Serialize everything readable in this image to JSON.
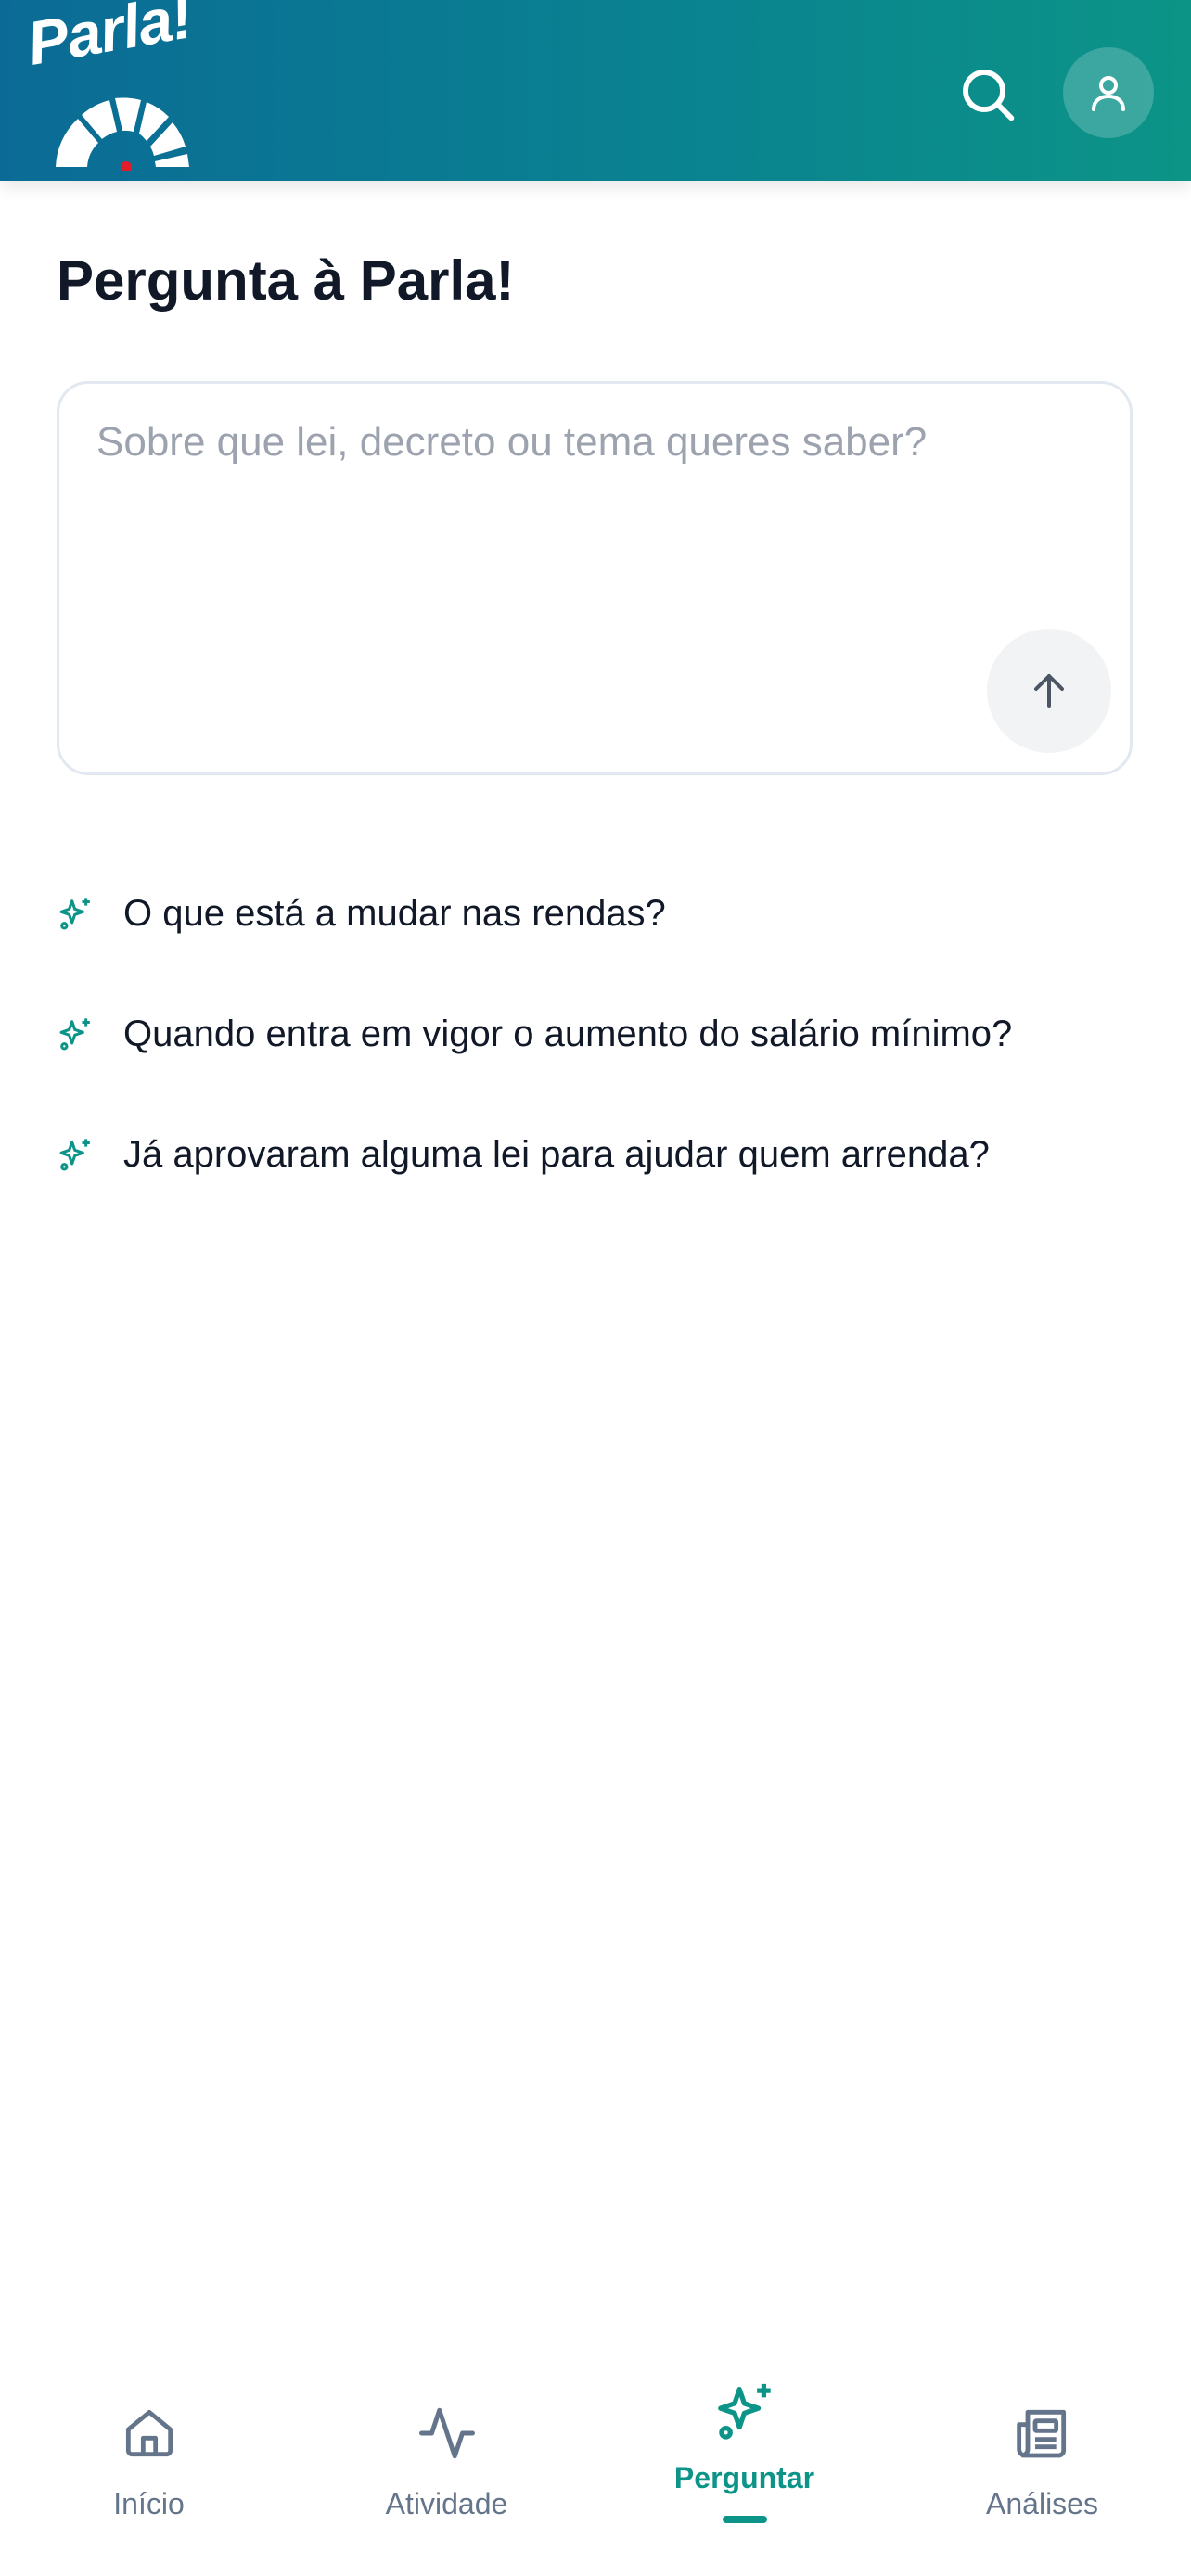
{
  "header": {
    "logo_text": "Parla!"
  },
  "page": {
    "title": "Pergunta à Parla!"
  },
  "question": {
    "placeholder": "Sobre que lei, decreto ou tema queres saber?",
    "value": ""
  },
  "suggestions": [
    {
      "text": "O que está a mudar nas rendas?"
    },
    {
      "text": "Quando entra em vigor o aumento do salário mínimo?"
    },
    {
      "text": "Já aprovaram alguma lei para ajudar quem arrenda?"
    }
  ],
  "nav": {
    "items": [
      {
        "label": "Início",
        "icon": "home-icon"
      },
      {
        "label": "Atividade",
        "icon": "activity-icon"
      },
      {
        "label": "Perguntar",
        "icon": "sparkles-icon",
        "active": true
      },
      {
        "label": "Análises",
        "icon": "newspaper-icon"
      }
    ]
  },
  "colors": {
    "accent": "#0d9488",
    "header_start": "#0b6b96",
    "header_end": "#0c9487",
    "nav_inactive": "#64748b",
    "logo_dot": "#e11d2a"
  }
}
